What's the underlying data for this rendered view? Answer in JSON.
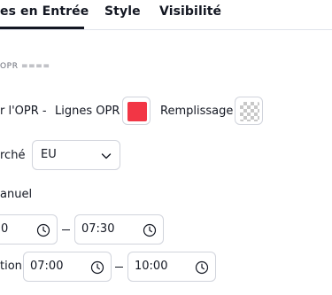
{
  "tabs": [
    {
      "label": "es en Entrée",
      "active": true
    },
    {
      "label": "Style",
      "active": false
    },
    {
      "label": "Visibilité",
      "active": false
    }
  ],
  "section": {
    "title": "OPR ===="
  },
  "opr_row": {
    "label": "r l'OPR -",
    "lines_label": "Lignes OPR",
    "lines_color": "#f23645",
    "fill_label": "Remplissage"
  },
  "market": {
    "label": "rché",
    "value": "EU"
  },
  "manual": {
    "label": "anuel"
  },
  "time_row1": {
    "start": "0",
    "end": "07:30"
  },
  "time_row2": {
    "label": "tion",
    "start": "07:00",
    "end": "10:00"
  }
}
